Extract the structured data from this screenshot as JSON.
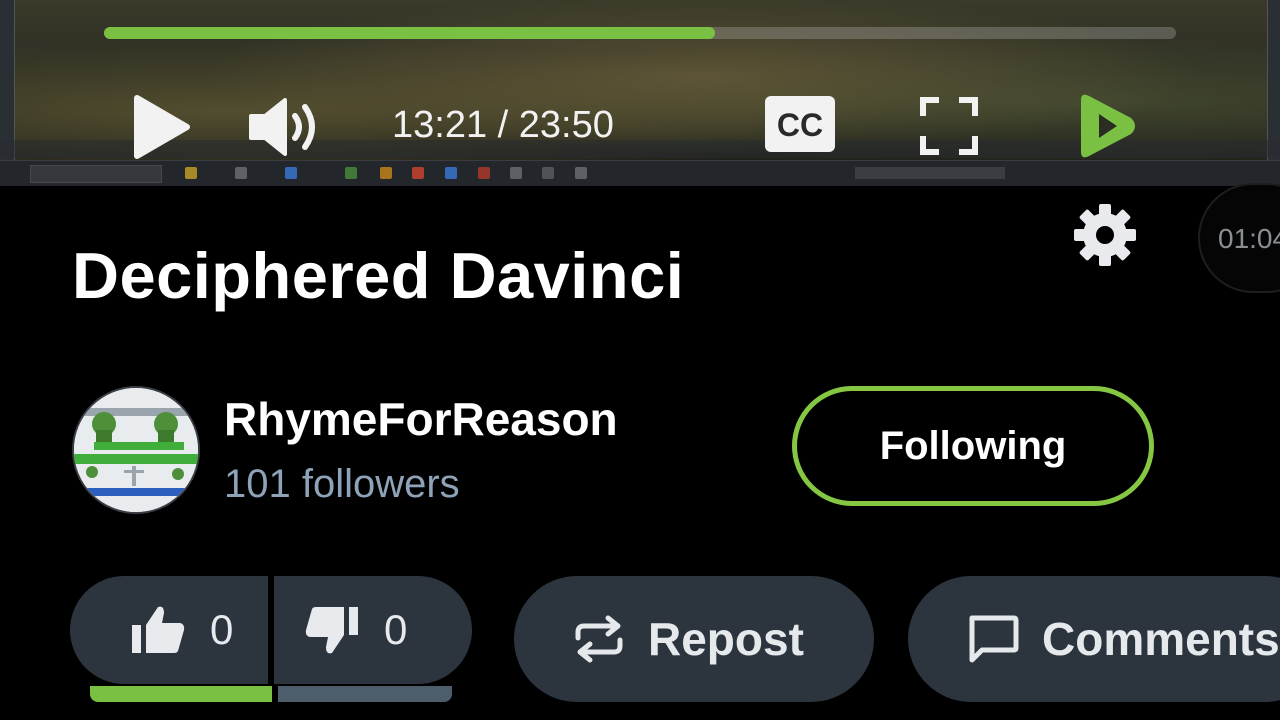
{
  "player": {
    "progress_fraction": 0.57,
    "time_display": "13:21 / 23:50",
    "play_icon": "play-icon",
    "volume_icon": "volume-icon",
    "cc_label": "CC",
    "fullscreen_icon": "fullscreen-icon",
    "logo_icon": "rumble-logo-icon",
    "accent_color": "#7ac143"
  },
  "video": {
    "title": "Deciphered Davinci"
  },
  "overlay": {
    "timer": "01:04"
  },
  "channel": {
    "name": "RhymeForReason",
    "followers": "101 followers",
    "follow_button": "Following"
  },
  "actions": {
    "likes": "0",
    "dislikes": "0",
    "like_fraction": 0.5,
    "repost_label": "Repost",
    "comment_label": "Comments"
  }
}
